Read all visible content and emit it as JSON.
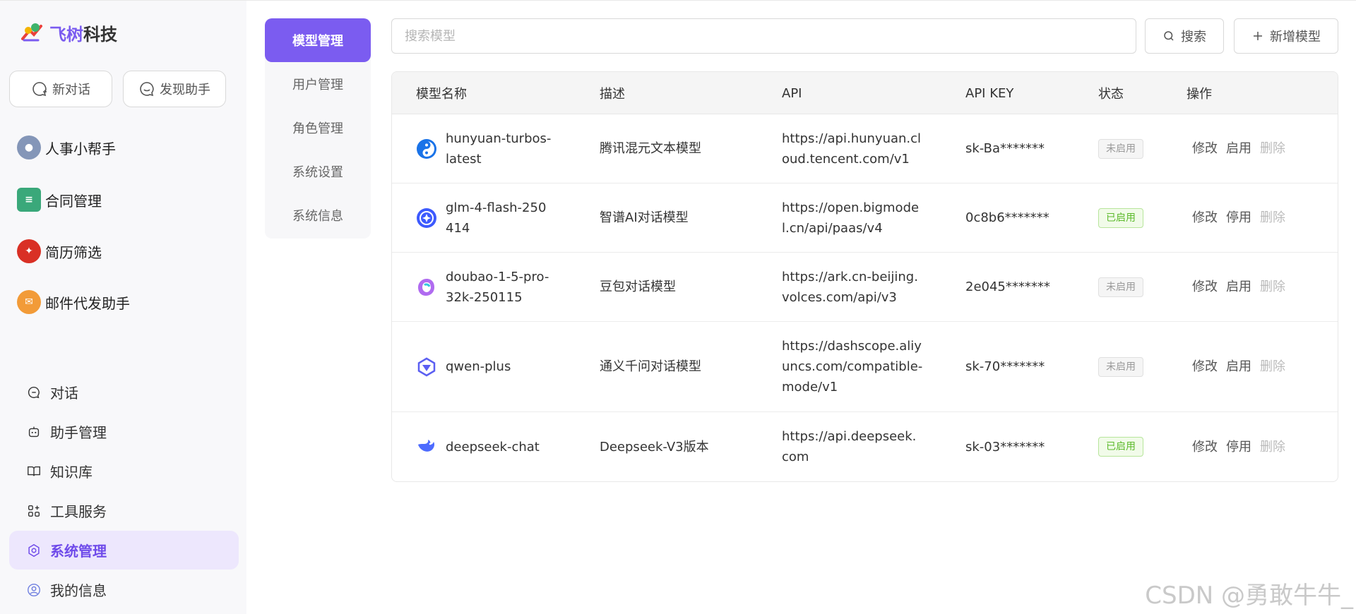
{
  "brand": {
    "prefix": "飞树",
    "suffix": "科技"
  },
  "sidebar": {
    "new_chat": "新对话",
    "discover": "发现助手",
    "assistants": [
      {
        "name": "人事小帮手",
        "color": "#7a8db0"
      },
      {
        "name": "合同管理",
        "color": "#3aa87a"
      },
      {
        "name": "简历筛选",
        "color": "#d93025"
      },
      {
        "name": "邮件代发助手",
        "color": "#f29b38"
      }
    ],
    "nav": [
      {
        "label": "对话",
        "icon": "chat-icon"
      },
      {
        "label": "助手管理",
        "icon": "robot-icon"
      },
      {
        "label": "知识库",
        "icon": "book-icon"
      },
      {
        "label": "工具服务",
        "icon": "apps-icon"
      },
      {
        "label": "系统管理",
        "icon": "settings-icon",
        "active": true
      },
      {
        "label": "我的信息",
        "icon": "user-icon"
      }
    ]
  },
  "submenu": [
    {
      "label": "模型管理",
      "active": true
    },
    {
      "label": "用户管理"
    },
    {
      "label": "角色管理"
    },
    {
      "label": "系统设置"
    },
    {
      "label": "系统信息"
    }
  ],
  "toolbar": {
    "search_placeholder": "搜索模型",
    "search_value": "",
    "search_label": "搜索",
    "add_label": "新增模型"
  },
  "table": {
    "headers": [
      "模型名称",
      "描述",
      "API",
      "API KEY",
      "状态",
      "操作"
    ],
    "ops": {
      "edit": "修改",
      "enable": "启用",
      "disable": "停用",
      "delete": "删除"
    },
    "rows": [
      {
        "name": "hunyuan-turbos-latest",
        "desc": "腾讯混元文本模型",
        "api": "https://api.hunyuan.cloud.tencent.com/v1",
        "key": "sk-Ba*******",
        "status": "未启用",
        "enabled": false,
        "icon": "hunyuan-icon"
      },
      {
        "name": "glm-4-flash-250414",
        "desc": "智谱AI对话模型",
        "api": "https://open.bigmodel.cn/api/paas/v4",
        "key": "0c8b6*******",
        "status": "已启用",
        "enabled": true,
        "icon": "zhipu-icon"
      },
      {
        "name": "doubao-1-5-pro-32k-250115",
        "desc": "豆包对话模型",
        "api": "https://ark.cn-beijing.volces.com/api/v3",
        "key": "2e045*******",
        "status": "未启用",
        "enabled": false,
        "icon": "doubao-icon"
      },
      {
        "name": "qwen-plus",
        "desc": "通义千问对话模型",
        "api": "https://dashscope.aliyuncs.com/compatible-mode/v1",
        "key": "sk-70*******",
        "status": "未启用",
        "enabled": false,
        "icon": "qwen-icon"
      },
      {
        "name": "deepseek-chat",
        "desc": "Deepseek-V3版本",
        "api": "https://api.deepseek.com",
        "key": "sk-03*******",
        "status": "已启用",
        "enabled": true,
        "icon": "deepseek-icon"
      }
    ]
  },
  "watermark": "CSDN @勇敢牛牛_"
}
